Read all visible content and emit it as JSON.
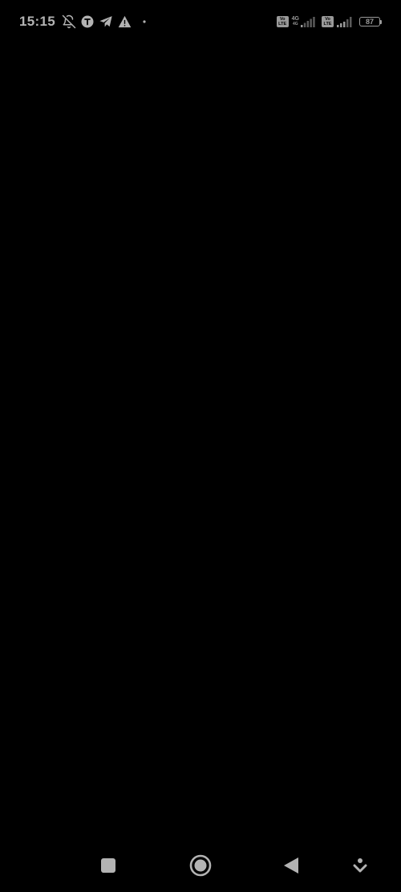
{
  "status_bar": {
    "time": "15:15",
    "left_icons": [
      "bell-off-icon",
      "t-app-icon",
      "telegram-icon",
      "warning-icon",
      "dot-icon"
    ],
    "sim1": {
      "badge_top": "Vo",
      "badge_bottom": "LTE",
      "network_top": "4G",
      "network_bottom": "4G"
    },
    "sim2": {
      "badge_top": "Vo",
      "badge_bottom": "LTE"
    },
    "battery_level": "87"
  },
  "nav_bar": {
    "buttons": [
      "recents-square-icon",
      "home-circle-icon",
      "back-triangle-icon",
      "keyboard-hide-icon"
    ]
  },
  "colors": {
    "background": "#000000",
    "icon": "#b3b3b3"
  }
}
